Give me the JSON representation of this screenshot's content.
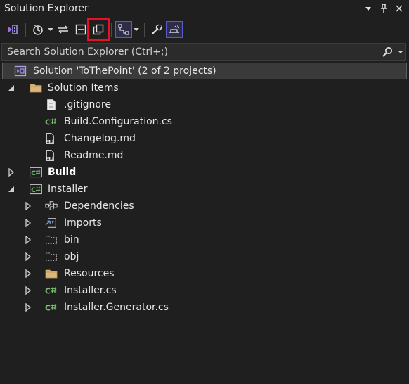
{
  "panel": {
    "title": "Solution Explorer",
    "actions": [
      {
        "icon": "dropdown-arrow-icon",
        "glyph": "▾"
      },
      {
        "icon": "pin-icon",
        "glyph": "📌"
      },
      {
        "icon": "close-icon",
        "glyph": "✕"
      }
    ]
  },
  "toolbar": {
    "buttons": [
      {
        "name": "switch-views-button",
        "icon": "vs-views-icon"
      },
      {
        "name": "pending-changes-filter-button",
        "icon": "clock-icon"
      },
      {
        "name": "sync-with-active-document-button",
        "icon": "sync-arrows-icon"
      },
      {
        "name": "collapse-all-button",
        "icon": "collapse-icon"
      },
      {
        "name": "show-all-files-button",
        "icon": "copy-icon"
      },
      {
        "name": "toggle-view-button",
        "icon": "tree-hierarchy-icon"
      },
      {
        "name": "properties-button",
        "icon": "wrench-icon"
      },
      {
        "name": "preview-selected-items-button",
        "icon": "preview-icon"
      }
    ]
  },
  "search": {
    "placeholder": "Search Solution Explorer (Ctrl+;)",
    "value": ""
  },
  "tree": [
    {
      "label": "Solution 'ToThePoint' (2 of 2 projects)",
      "icon": "solution-icon",
      "depth": 0,
      "arrow": "none",
      "selected": true,
      "bold": false
    },
    {
      "label": "Solution Items",
      "icon": "folder-icon",
      "depth": 1,
      "arrow": "expanded",
      "selected": false,
      "bold": false
    },
    {
      "label": ".gitignore",
      "icon": "file-icon",
      "depth": 2,
      "arrow": "none",
      "selected": false,
      "bold": false
    },
    {
      "label": "Build.Configuration.cs",
      "icon": "csharp-file-icon",
      "depth": 2,
      "arrow": "none",
      "selected": false,
      "bold": false
    },
    {
      "label": "Changelog.md",
      "icon": "markdown-file-icon",
      "depth": 2,
      "arrow": "none",
      "selected": false,
      "bold": false
    },
    {
      "label": "Readme.md",
      "icon": "markdown-file-icon",
      "depth": 2,
      "arrow": "none",
      "selected": false,
      "bold": false
    },
    {
      "label": "Build",
      "icon": "csharp-project-icon",
      "depth": 1,
      "arrow": "collapsed",
      "selected": false,
      "bold": true
    },
    {
      "label": "Installer",
      "icon": "csharp-project-icon",
      "depth": 1,
      "arrow": "expanded",
      "selected": false,
      "bold": false
    },
    {
      "label": "Dependencies",
      "icon": "dependencies-icon",
      "depth": 2,
      "arrow": "collapsed",
      "selected": false,
      "bold": false
    },
    {
      "label": "Imports",
      "icon": "imports-icon",
      "depth": 2,
      "arrow": "collapsed",
      "selected": false,
      "bold": false
    },
    {
      "label": "bin",
      "icon": "hidden-folder-icon",
      "depth": 2,
      "arrow": "collapsed",
      "selected": false,
      "bold": false
    },
    {
      "label": "obj",
      "icon": "hidden-folder-icon",
      "depth": 2,
      "arrow": "collapsed",
      "selected": false,
      "bold": false
    },
    {
      "label": "Resources",
      "icon": "folder-icon",
      "depth": 2,
      "arrow": "collapsed",
      "selected": false,
      "bold": false
    },
    {
      "label": "Installer.cs",
      "icon": "csharp-file-icon",
      "depth": 2,
      "arrow": "collapsed",
      "selected": false,
      "bold": false
    },
    {
      "label": "Installer.Generator.cs",
      "icon": "csharp-file-icon",
      "depth": 2,
      "arrow": "collapsed",
      "selected": false,
      "bold": false
    }
  ],
  "colors": {
    "background": "#1f1f1f",
    "folder": "#dcb67a",
    "csharp": "#7ac070",
    "highlight_outline": "#e81123",
    "active_toggle": "#5a5ac8"
  }
}
